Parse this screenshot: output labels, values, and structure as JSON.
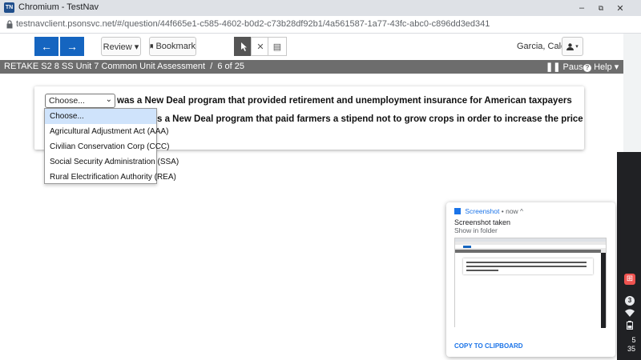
{
  "window": {
    "app_icon_text": "TN",
    "title": "Chromium - TestNav",
    "minimize": "–",
    "maximize": "⧉",
    "close": "✕"
  },
  "address": {
    "url": "testnavclient.psonsvc.net/#/question/44f665e1-c585-4602-b0d2-c73b28df92b1/4a561587-1a77-43fc-abc0-c896dd3ed341"
  },
  "toolbar": {
    "back_icon": "←",
    "forward_icon": "→",
    "review_label": "Review ▾",
    "bookmark_label": "Bookmark",
    "pointer_icon": "pointer-icon",
    "eliminate_icon": "✕",
    "notepad_icon": "▤",
    "user_name": "Garcia, Caleb",
    "user_menu_icon": "▴▾"
  },
  "status": {
    "assessment": "RETAKE S2 8 SS Unit 7 Common Unit Assessment",
    "separator": "/",
    "progress": "6 of 25",
    "pause_label": "Pause",
    "help_label": "Help"
  },
  "question": {
    "line1_text": "was a New Deal program that provided retirement and unemployment insurance for American taxpayers",
    "line2_text": "s a New Deal program that paid farmers a stipend not to grow crops in order to increase the price",
    "select_value": "Choose...",
    "options": [
      "Choose...",
      "Agricultural Adjustment Act (AAA)",
      "Civilian Conservation Corp (CCC)",
      "Social Security Administration (SSA)",
      "Rural Electrification Authority (REA)"
    ]
  },
  "notification": {
    "source": "Screenshot",
    "time": "now",
    "title": "Screenshot taken",
    "subtitle": "Show in folder",
    "action": "COPY TO CLIPBOARD"
  },
  "shelf": {
    "badge": "3",
    "clock_hour": "5",
    "clock_minute": "35"
  },
  "colors": {
    "nav_blue": "#1565c0",
    "status_bar": "#6d6d6d",
    "link_blue": "#1a73e8"
  }
}
